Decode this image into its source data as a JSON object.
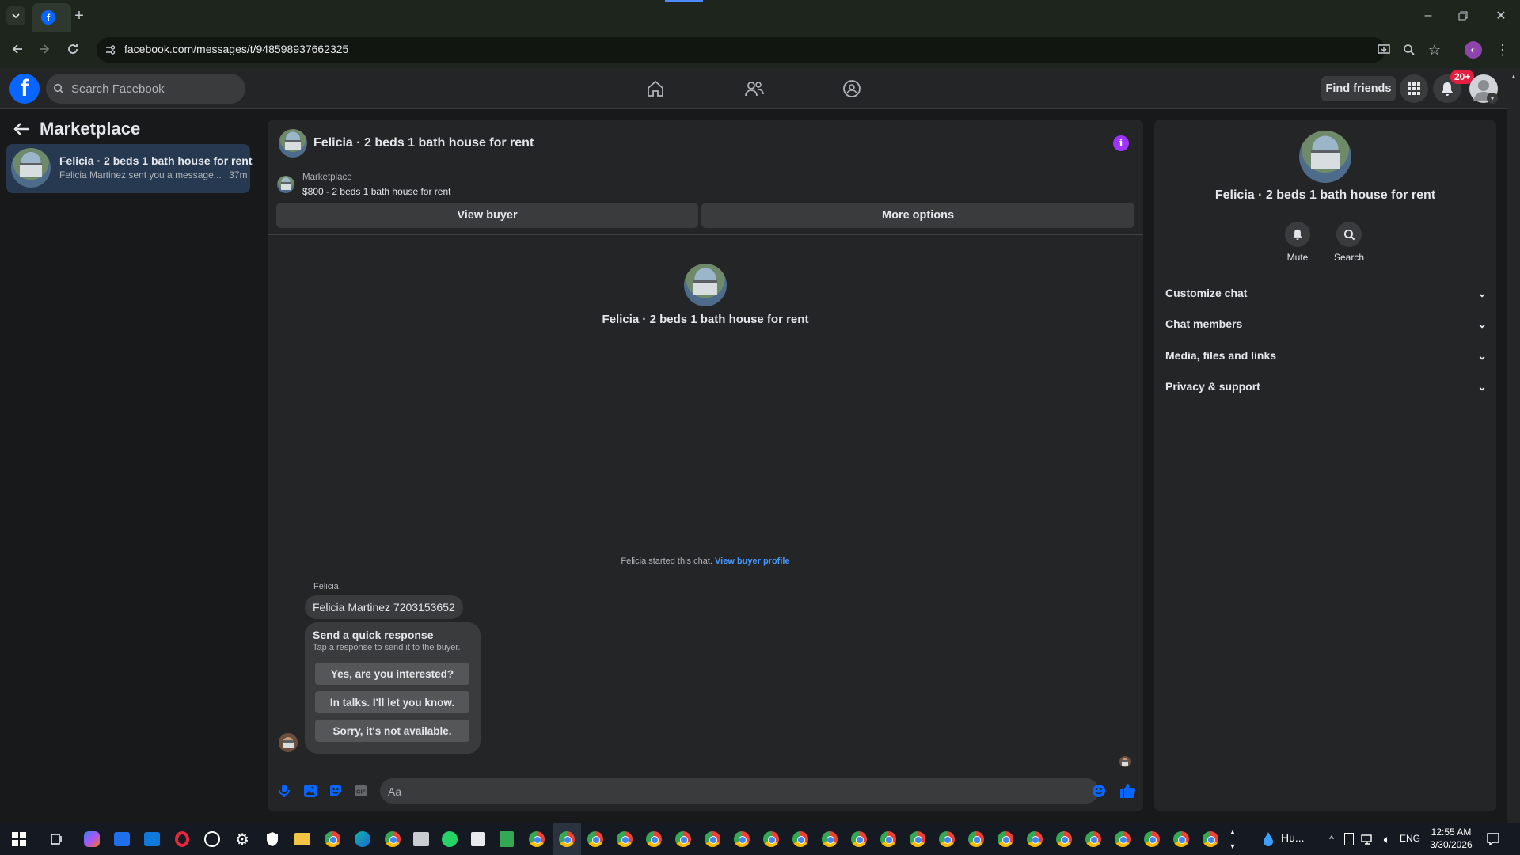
{
  "browser": {
    "url": "facebook.com/messages/t/948598937662325"
  },
  "header": {
    "search_placeholder": "Search Facebook",
    "find_friends": "Find friends",
    "notif_badge": "20+"
  },
  "sidebar": {
    "title": "Marketplace",
    "conversation": {
      "title": "Felicia · 2 beds 1 bath house for rent",
      "preview": "Felicia Martinez sent you a message...",
      "time": "37m"
    }
  },
  "chat": {
    "title": "Felicia · 2 beds 1 bath house for rent",
    "marketplace_label": "Marketplace",
    "listing": "$800 - 2 beds 1 bath house for rent",
    "view_buyer": "View buyer",
    "more_options": "More options",
    "center_name": "Felicia · 2 beds 1 bath house for rent",
    "started_text": "Felicia started this chat.",
    "view_buyer_profile": "View buyer profile",
    "sender": "Felicia",
    "message": "Felicia Martinez 7203153652",
    "quick": {
      "title": "Send a quick response",
      "subtitle": "Tap a response to send it to the buyer.",
      "options": [
        "Yes, are you interested?",
        "In talks. I'll let you know.",
        "Sorry, it's not available."
      ]
    },
    "composer_placeholder": "Aa"
  },
  "details": {
    "name": "Felicia · 2 beds 1 bath house for rent",
    "mute": "Mute",
    "search": "Search",
    "sections": [
      "Customize chat",
      "Chat members",
      "Media, files and links",
      "Privacy & support"
    ]
  },
  "taskbar": {
    "weather": "Hu...",
    "lang": "ENG",
    "time": "12:55 AM",
    "date": "3/30/2026"
  },
  "colors": {
    "accent": "#0866ff",
    "link": "#4599ff",
    "info_icon": "#a033ff",
    "badge": "#e41e3f"
  }
}
